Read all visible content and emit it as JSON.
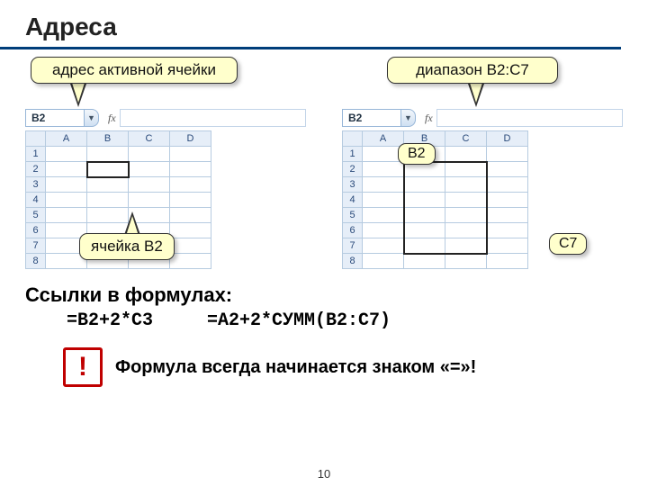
{
  "title": "Адреса",
  "callouts": {
    "active_addr": "адрес активной ячейки",
    "range": "диапазон B2:C7",
    "cell": "ячейка B2",
    "b2": "B2",
    "c7": "C7"
  },
  "sheet": {
    "namebox": "B2",
    "fx_label": "fx",
    "cols": [
      "A",
      "B",
      "C",
      "D"
    ],
    "rows": [
      "1",
      "2",
      "3",
      "4",
      "5",
      "6",
      "7",
      "8"
    ]
  },
  "links": {
    "heading": "Ссылки в формулах:",
    "f1": "=B2+2*C3",
    "f2": "=A2+2*СУММ(B2:C7)"
  },
  "warning": {
    "mark": "!",
    "text": "Формула всегда начинается знаком «=»!"
  },
  "page": "10"
}
